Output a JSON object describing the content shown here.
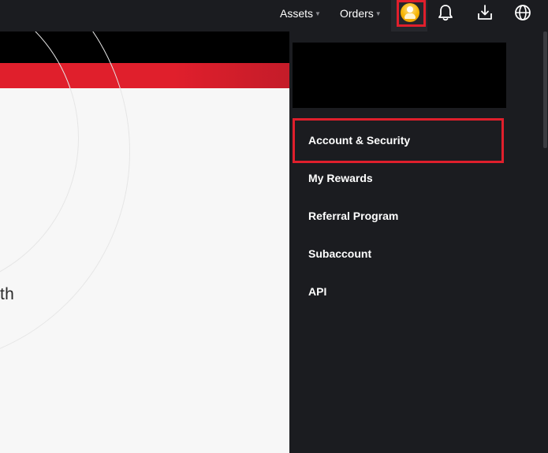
{
  "colors": {
    "accent": "#e01f2c",
    "panel_background": "#1b1c20",
    "content_background": "#f7f7f7",
    "avatar": "#f7b500"
  },
  "header": {
    "nav": [
      {
        "label": "Assets",
        "icon": "caret-down-icon"
      },
      {
        "label": "Orders",
        "icon": "caret-down-icon"
      }
    ],
    "icons": [
      "user-avatar-icon",
      "bell-icon",
      "download-icon",
      "globe-icon"
    ]
  },
  "content": {
    "partial_text": "th"
  },
  "account_menu": {
    "items": [
      {
        "label": "Account & Security",
        "highlighted": true
      },
      {
        "label": "My Rewards"
      },
      {
        "label": "Referral Program"
      },
      {
        "label": "Subaccount"
      },
      {
        "label": "API"
      }
    ]
  }
}
